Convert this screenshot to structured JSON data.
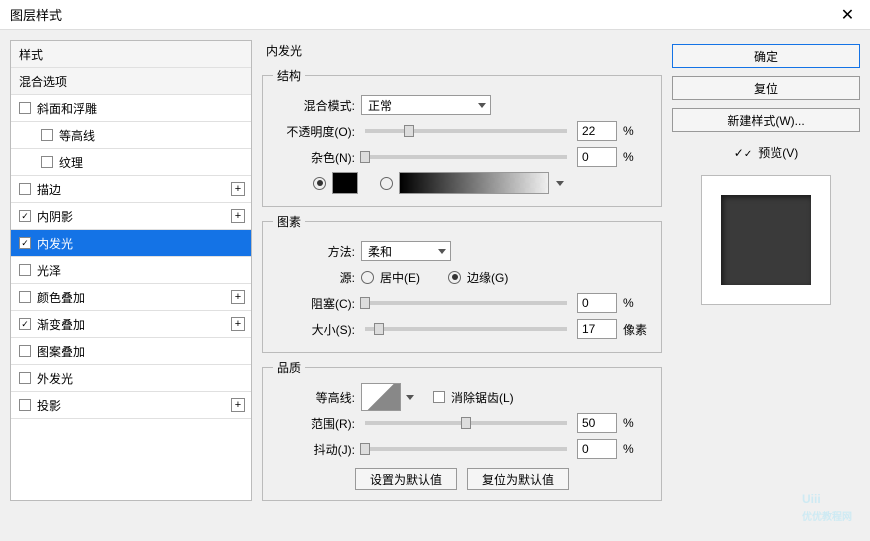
{
  "title": "图层样式",
  "left": {
    "style_header": "样式",
    "blend_options": "混合选项",
    "bevel": "斜面和浮雕",
    "contour": "等高线",
    "texture": "纹理",
    "stroke": "描边",
    "inner_shadow": "内阴影",
    "inner_glow": "内发光",
    "satin": "光泽",
    "color_overlay": "颜色叠加",
    "gradient_overlay": "渐变叠加",
    "pattern_overlay": "图案叠加",
    "outer_glow": "外发光",
    "drop_shadow": "投影"
  },
  "center": {
    "panel_title": "内发光",
    "struct_group": "结构",
    "blend_mode_label": "混合模式:",
    "blend_mode_value": "正常",
    "opacity_label": "不透明度(O):",
    "opacity_value": "22",
    "noise_label": "杂色(N):",
    "noise_value": "0",
    "pct": "%",
    "elements_group": "图素",
    "technique_label": "方法:",
    "technique_value": "柔和",
    "source_label": "源:",
    "source_center": "居中(E)",
    "source_edge": "边缘(G)",
    "choke_label": "阻塞(C):",
    "choke_value": "0",
    "size_label": "大小(S):",
    "size_value": "17",
    "px": "像素",
    "quality_group": "品质",
    "contour_label": "等高线:",
    "aa_label": "消除锯齿(L)",
    "range_label": "范围(R):",
    "range_value": "50",
    "jitter_label": "抖动(J):",
    "jitter_value": "0",
    "make_default": "设置为默认值",
    "reset_default": "复位为默认值"
  },
  "right": {
    "ok": "确定",
    "cancel": "复位",
    "new_style": "新建样式(W)...",
    "preview": "预览(V)"
  },
  "watermark": {
    "main": "Uiii",
    "sub": "优优教程网"
  }
}
